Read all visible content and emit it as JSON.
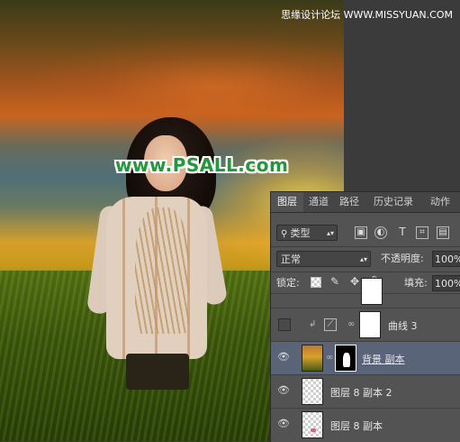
{
  "watermarks": {
    "site": "www.PSALL.com",
    "corner": "思缘设计论坛 WWW.MISSYUAN.COM"
  },
  "panel": {
    "tabs": [
      "图层",
      "通道",
      "路径",
      "历史记录",
      "动作"
    ],
    "active_tab": "图层",
    "filter_label": "类型",
    "blend_mode": "正常",
    "opacity_label": "不透明度:",
    "opacity_value": "100%",
    "lock_label": "锁定:",
    "fill_label": "填充:",
    "fill_value": "100%",
    "layers": [
      {
        "name": "曲线 3",
        "visible": false,
        "selected": false,
        "type": "adjustment"
      },
      {
        "name": "背景 副本",
        "visible": true,
        "selected": true,
        "type": "masked"
      },
      {
        "name": "图层 8 副本 2",
        "visible": true,
        "selected": false,
        "type": "transparent"
      },
      {
        "name": "图层 8 副本",
        "visible": true,
        "selected": false,
        "type": "transparent"
      }
    ]
  },
  "icons": [
    "filter-dropdown-icon",
    "image-filter-icon",
    "adjustment-filter-icon",
    "text-filter-icon",
    "shape-filter-icon",
    "smart-object-filter-icon",
    "lock-transparent-icon",
    "lock-paint-icon",
    "lock-position-icon",
    "lock-all-icon",
    "eye-icon",
    "link-chain-icon",
    "curves-icon",
    "clip-arrow-icon"
  ],
  "colors": {
    "panel_bg": "#535353",
    "selected_layer": "#596479",
    "watermark_green": "#1f9a3a"
  }
}
